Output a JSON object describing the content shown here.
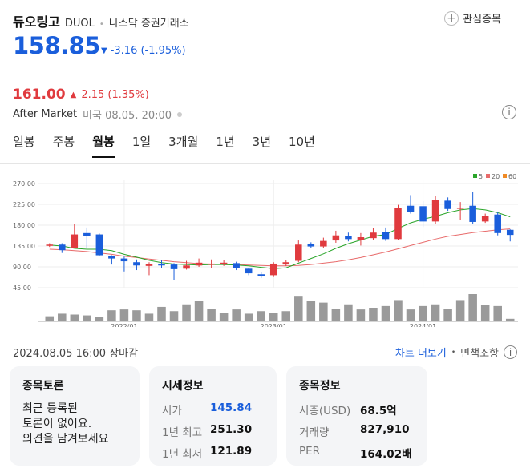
{
  "header": {
    "name": "듀오링고",
    "ticker": "DUOL",
    "dot": "•",
    "exchange": "나스닥 증권거래소",
    "watch_label": "관심종목"
  },
  "quote": {
    "price": "158.85",
    "arrow": "▼",
    "change": "-3.16 (-1.95%)"
  },
  "after_market": {
    "price": "161.00",
    "arrow": "▲",
    "change": "2.15 (1.35%)",
    "label": "After Market",
    "sub": "미국 08.05. 20:00"
  },
  "tabs": [
    "일봉",
    "주봉",
    "월봉",
    "1일",
    "3개월",
    "1년",
    "3년",
    "10년"
  ],
  "active_tab": "월봉",
  "timestamp": "2024.08.05 16:00 장마감",
  "links": {
    "chart_more": "차트 더보기",
    "dot": "•",
    "disclaimer": "면책조항"
  },
  "colors": {
    "up": "#e03a3e",
    "down": "#1a5edb",
    "ma5": "#2aa52a",
    "ma20": "#e86b6b",
    "ma60": "#f08a24"
  },
  "chart_data": {
    "type": "candlestick",
    "legend": [
      {
        "label": "5"
      },
      {
        "label": "20"
      },
      {
        "label": "60"
      }
    ],
    "y_ticks": [
      "270.00",
      "225.00",
      "180.00",
      "135.00",
      "90.00",
      "45.00"
    ],
    "ylim": [
      45,
      270
    ],
    "x_ticks": [
      {
        "label": "2022/01",
        "index": 6
      },
      {
        "label": "2023/01",
        "index": 18
      },
      {
        "label": "2024/01",
        "index": 30
      }
    ],
    "candles": [
      {
        "o": 138,
        "c": 138,
        "h": 141,
        "l": 133
      },
      {
        "o": 138,
        "c": 126,
        "h": 141,
        "l": 120
      },
      {
        "o": 131,
        "c": 160,
        "h": 182,
        "l": 131
      },
      {
        "o": 163,
        "c": 157,
        "h": 175,
        "l": 130
      },
      {
        "o": 160,
        "c": 115,
        "h": 162,
        "l": 113
      },
      {
        "o": 113,
        "c": 108,
        "h": 115,
        "l": 95
      },
      {
        "o": 108,
        "c": 102,
        "h": 112,
        "l": 80
      },
      {
        "o": 100,
        "c": 93,
        "h": 106,
        "l": 83
      },
      {
        "o": 92,
        "c": 96,
        "h": 100,
        "l": 72
      },
      {
        "o": 97,
        "c": 93,
        "h": 105,
        "l": 87
      },
      {
        "o": 95,
        "c": 85,
        "h": 98,
        "l": 62
      },
      {
        "o": 86,
        "c": 93,
        "h": 103,
        "l": 84
      },
      {
        "o": 93,
        "c": 99,
        "h": 108,
        "l": 90
      },
      {
        "o": 95,
        "c": 97,
        "h": 106,
        "l": 88
      },
      {
        "o": 97,
        "c": 99,
        "h": 104,
        "l": 92
      },
      {
        "o": 98,
        "c": 88,
        "h": 101,
        "l": 83
      },
      {
        "o": 86,
        "c": 76,
        "h": 88,
        "l": 72
      },
      {
        "o": 74,
        "c": 70,
        "h": 78,
        "l": 66
      },
      {
        "o": 72,
        "c": 97,
        "h": 100,
        "l": 68
      },
      {
        "o": 95,
        "c": 100,
        "h": 104,
        "l": 92
      },
      {
        "o": 103,
        "c": 138,
        "h": 147,
        "l": 100
      },
      {
        "o": 140,
        "c": 134,
        "h": 143,
        "l": 130
      },
      {
        "o": 134,
        "c": 146,
        "h": 153,
        "l": 130
      },
      {
        "o": 147,
        "c": 158,
        "h": 168,
        "l": 142
      },
      {
        "o": 157,
        "c": 150,
        "h": 164,
        "l": 145
      },
      {
        "o": 148,
        "c": 154,
        "h": 163,
        "l": 136
      },
      {
        "o": 152,
        "c": 164,
        "h": 174,
        "l": 148
      },
      {
        "o": 165,
        "c": 150,
        "h": 175,
        "l": 146
      },
      {
        "o": 150,
        "c": 218,
        "h": 224,
        "l": 148
      },
      {
        "o": 222,
        "c": 208,
        "h": 245,
        "l": 205
      },
      {
        "o": 221,
        "c": 188,
        "h": 232,
        "l": 176
      },
      {
        "o": 188,
        "c": 235,
        "h": 243,
        "l": 182
      },
      {
        "o": 233,
        "c": 215,
        "h": 240,
        "l": 211
      },
      {
        "o": 217,
        "c": 218,
        "h": 230,
        "l": 192
      },
      {
        "o": 222,
        "c": 187,
        "h": 251,
        "l": 182
      },
      {
        "o": 188,
        "c": 200,
        "h": 205,
        "l": 185
      },
      {
        "o": 203,
        "c": 163,
        "h": 209,
        "l": 158
      },
      {
        "o": 170,
        "c": 159,
        "h": 171,
        "l": 145
      }
    ],
    "ma5": [
      137,
      135,
      130,
      128,
      128,
      125,
      117,
      111,
      104,
      99,
      96,
      95,
      94,
      95,
      95,
      94,
      92,
      89,
      86,
      88,
      98,
      108,
      118,
      130,
      140,
      148,
      156,
      160,
      173,
      185,
      193,
      199,
      207,
      213,
      216,
      213,
      207,
      198
    ],
    "ma20": [
      128,
      127,
      125,
      123,
      120,
      117,
      113,
      110,
      107,
      104,
      101,
      99,
      97,
      96,
      95,
      95,
      94,
      93,
      92,
      92,
      93,
      95,
      98,
      101,
      105,
      110,
      116,
      122,
      129,
      136,
      143,
      150,
      156,
      160,
      164,
      167,
      170,
      172
    ],
    "volumes": [
      6,
      9,
      8,
      7,
      5,
      13,
      14,
      13,
      9,
      17,
      12,
      20,
      24,
      15,
      10,
      14,
      9,
      12,
      10,
      12,
      29,
      24,
      22,
      15,
      20,
      14,
      16,
      18,
      25,
      14,
      18,
      20,
      15,
      25,
      32,
      19,
      18,
      3
    ]
  },
  "cards": {
    "discussion": {
      "title": "종목토론",
      "line1": "최근 등록된",
      "line2": "토론이 없어요.",
      "line3": "의견을 남겨보세요"
    },
    "market": {
      "title": "시세정보",
      "rows": [
        {
          "k": "시가",
          "v": "145.84"
        },
        {
          "k": "1년 최고",
          "v": "251.30"
        },
        {
          "k": "1년 최저",
          "v": "121.89"
        }
      ]
    },
    "stock": {
      "title": "종목정보",
      "rows": [
        {
          "k": "시총(USD)",
          "v": "68.5억"
        },
        {
          "k": "거래량",
          "v": "827,910"
        },
        {
          "k": "PER",
          "v": "164.02배"
        }
      ]
    }
  }
}
